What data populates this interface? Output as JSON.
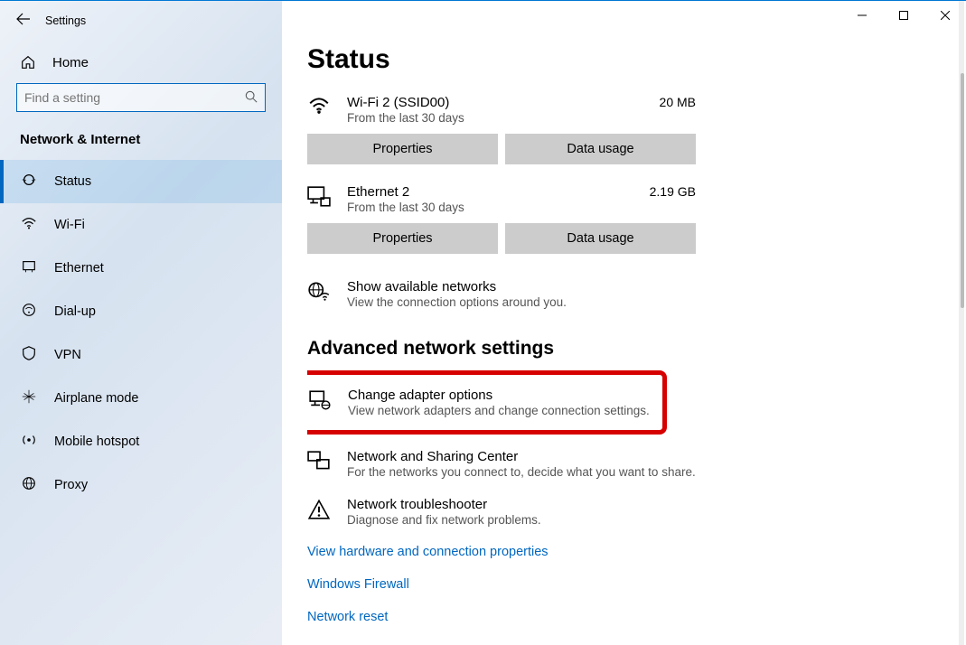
{
  "app_title": "Settings",
  "home_label": "Home",
  "search_placeholder": "Find a setting",
  "category": "Network & Internet",
  "sidebar": {
    "items": [
      {
        "label": "Status",
        "icon": "status-icon"
      },
      {
        "label": "Wi-Fi",
        "icon": "wifi-icon"
      },
      {
        "label": "Ethernet",
        "icon": "ethernet-icon"
      },
      {
        "label": "Dial-up",
        "icon": "dialup-icon"
      },
      {
        "label": "VPN",
        "icon": "vpn-icon"
      },
      {
        "label": "Airplane mode",
        "icon": "airplane-icon"
      },
      {
        "label": "Mobile hotspot",
        "icon": "hotspot-icon"
      },
      {
        "label": "Proxy",
        "icon": "proxy-icon"
      }
    ]
  },
  "page_title": "Status",
  "networks": [
    {
      "name": "Wi-Fi 2 (SSID00)",
      "sub": "From the last 30 days",
      "usage": "20 MB",
      "btn1": "Properties",
      "btn2": "Data usage"
    },
    {
      "name": "Ethernet 2",
      "sub": "From the last 30 days",
      "usage": "2.19 GB",
      "btn1": "Properties",
      "btn2": "Data usage"
    }
  ],
  "show_available": {
    "title": "Show available networks",
    "sub": "View the connection options around you."
  },
  "adv_heading": "Advanced network settings",
  "adapter": {
    "title": "Change adapter options",
    "sub": "View network adapters and change connection settings."
  },
  "sharing": {
    "title": "Network and Sharing Center",
    "sub": "For the networks you connect to, decide what you want to share."
  },
  "troubleshoot": {
    "title": "Network troubleshooter",
    "sub": "Diagnose and fix network problems."
  },
  "links": {
    "hw": "View hardware and connection properties",
    "fw": "Windows Firewall",
    "reset": "Network reset"
  }
}
